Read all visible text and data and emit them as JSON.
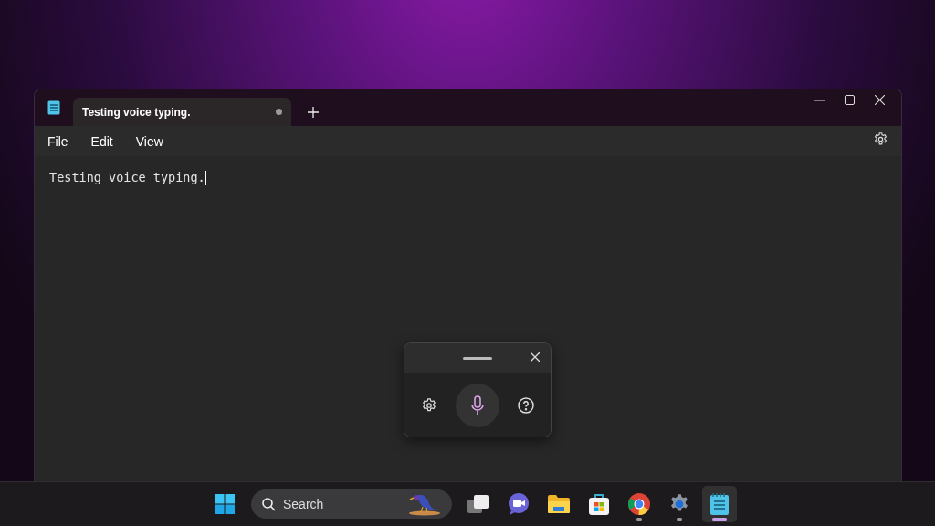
{
  "window": {
    "tabs": [
      {
        "title": "Testing voice typing.",
        "selected": true,
        "modified": true
      }
    ],
    "menu": [
      {
        "label": "File"
      },
      {
        "label": "Edit"
      },
      {
        "label": "View"
      }
    ],
    "editor": {
      "text": "Testing voice typing."
    }
  },
  "taskbar": {
    "search": {
      "placeholder": "Search"
    },
    "apps": [
      {
        "kind": "start",
        "running": false,
        "active": false
      },
      {
        "kind": "search"
      },
      {
        "kind": "task-view",
        "running": false,
        "active": false
      },
      {
        "kind": "chat",
        "running": false,
        "active": false
      },
      {
        "kind": "file-explorer",
        "running": false,
        "active": false
      },
      {
        "kind": "store",
        "running": false,
        "active": false
      },
      {
        "kind": "browser",
        "running": true,
        "active": false
      },
      {
        "kind": "settings",
        "running": true,
        "active": false
      },
      {
        "kind": "notepad",
        "running": true,
        "active": true
      }
    ]
  }
}
